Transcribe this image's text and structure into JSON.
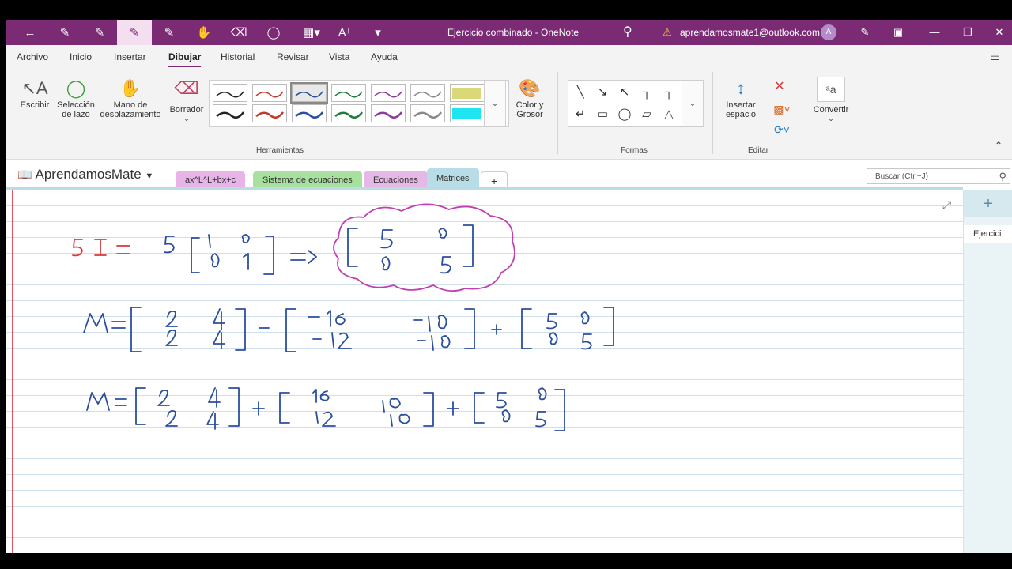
{
  "titlebar": {
    "title": "Ejercicio combinado  -  OneNote",
    "account": "aprendamosmate1@outlook.com",
    "avatar_initial": "A",
    "icons": [
      "back-icon",
      "pen-icon",
      "pen-red-icon",
      "pen-active-icon",
      "pen-green-icon",
      "hand-icon",
      "eraser-icon",
      "lasso-icon",
      "columns-icon",
      "ink-to-text-icon",
      "customize-icon"
    ]
  },
  "menu": {
    "items": [
      "Archivo",
      "Inicio",
      "Insertar",
      "Dibujar",
      "Historial",
      "Revisar",
      "Vista",
      "Ayuda"
    ],
    "active": "Dibujar"
  },
  "ribbon": {
    "tools": {
      "write": "Escribir",
      "lasso_line1": "Selección",
      "lasso_line2": "de lazo",
      "hand_line1": "Mano de",
      "hand_line2": "desplazamiento",
      "eraser": "Borrador",
      "color_line1": "Color y",
      "color_line2": "Grosor",
      "insert_space_line1": "Insertar",
      "insert_space_line2": "espacio",
      "convert": "Convertir"
    },
    "groups": {
      "tools": "Herramientas",
      "shapes": "Formas",
      "edit": "Editar"
    },
    "pen_colors": [
      "#222222",
      "#c0392b",
      "#2b4f9e",
      "#1e7b3a",
      "#8e3a9e",
      "#888888",
      "#d9d97a",
      "#1fe5f0"
    ]
  },
  "notebook": {
    "name": "AprendamosMate",
    "tabs": [
      {
        "label": "ax^L^L+bx+c",
        "color": "#e8b4e8"
      },
      {
        "label": "Sistema de ecuaciones",
        "color": "#a8e0a0"
      },
      {
        "label": "Ecuaciones",
        "color": "#e6b8e6"
      },
      {
        "label": "Matrices",
        "color": "#b9dde6"
      },
      {
        "label": "+",
        "color": "#ffffff"
      }
    ],
    "search_placeholder": "Buscar (Ctrl+J)"
  },
  "page": {
    "page_list_item": "Ejercici"
  }
}
